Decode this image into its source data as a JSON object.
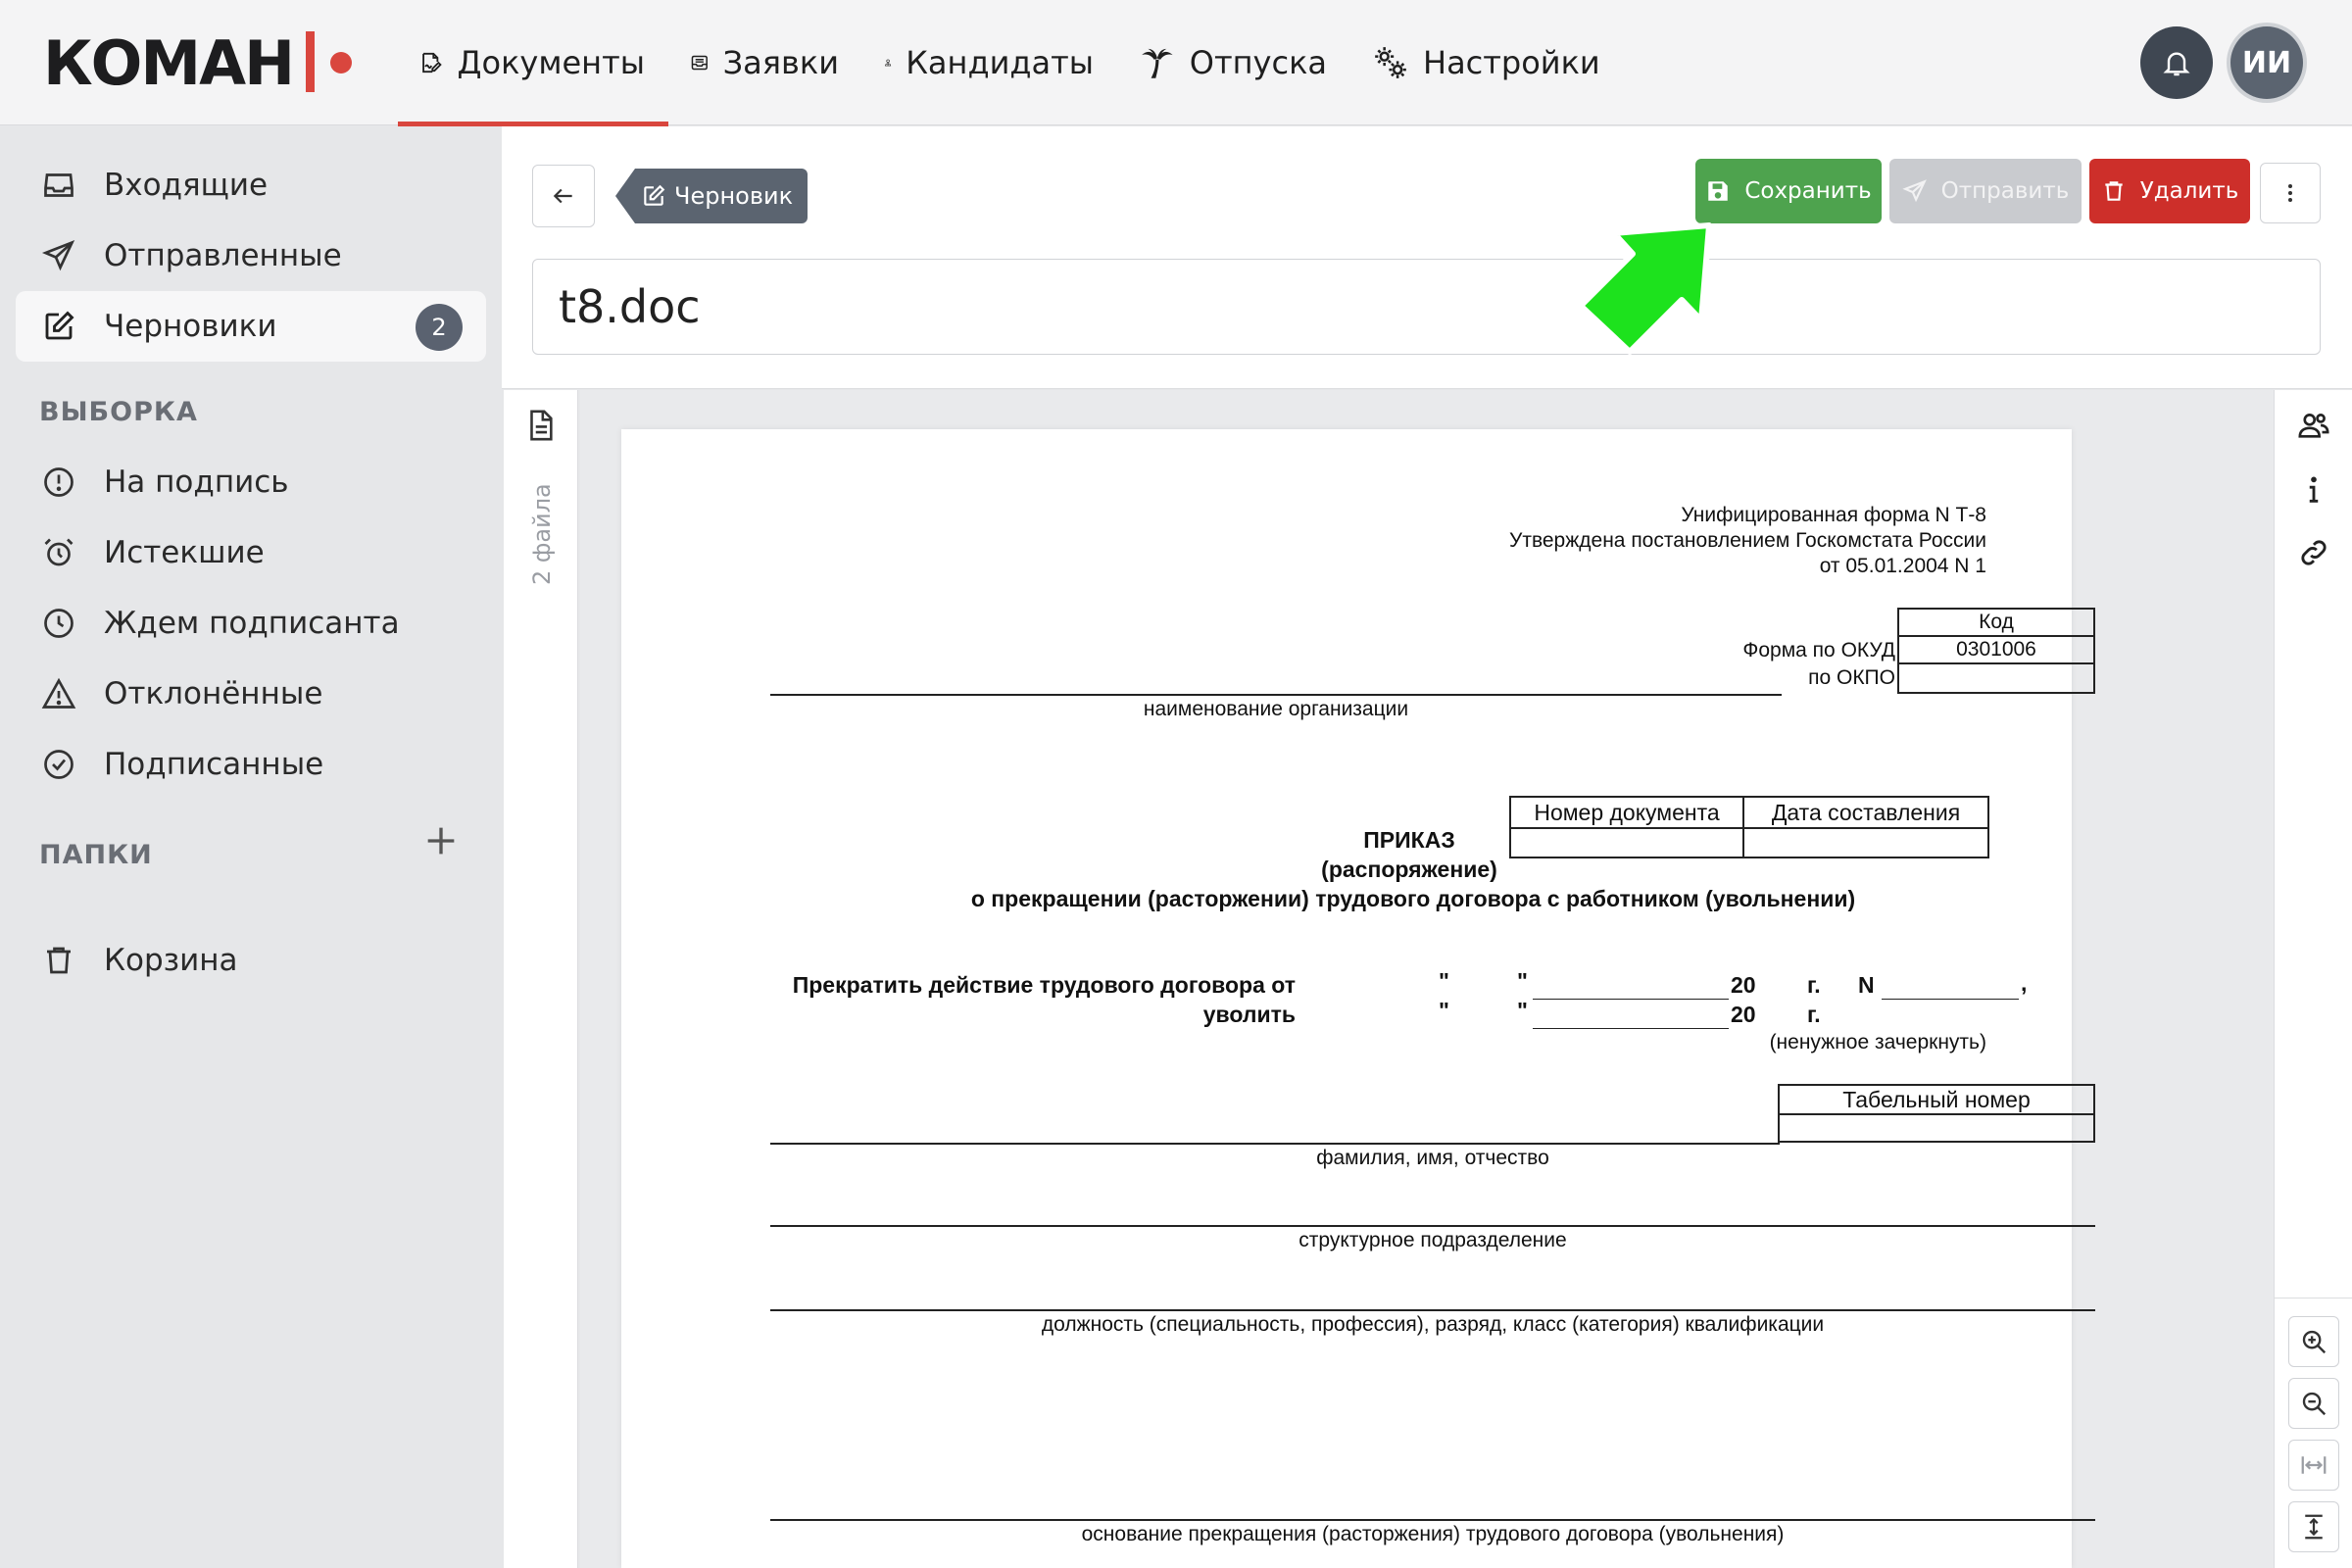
{
  "brand": {
    "name": "КОМАН"
  },
  "nav": [
    {
      "label": "Документы",
      "icon": "document-sign-icon",
      "active": true
    },
    {
      "label": "Заявки",
      "icon": "inbox-tray-icon"
    },
    {
      "label": "Кандидаты",
      "icon": "user-tie-icon"
    },
    {
      "label": "Отпуска",
      "icon": "palm-tree-icon"
    },
    {
      "label": "Настройки",
      "icon": "gears-icon"
    }
  ],
  "header": {
    "avatar_initials": "ИИ",
    "bell_icon": "bell-icon"
  },
  "sidebar": {
    "items": [
      {
        "label": "Входящие",
        "icon": "inbox-icon"
      },
      {
        "label": "Отправленные",
        "icon": "paper-plane-icon"
      },
      {
        "label": "Черновики",
        "icon": "edit-icon",
        "active": true,
        "badge": "2"
      }
    ],
    "filter_title": "ВЫБОРКА",
    "filters": [
      {
        "label": "На подпись",
        "icon": "exclamation-circle-icon"
      },
      {
        "label": "Истекшие",
        "icon": "alarm-clock-icon"
      },
      {
        "label": "Ждем подписанта",
        "icon": "clock-icon"
      },
      {
        "label": "Отклонённые",
        "icon": "warning-triangle-icon"
      },
      {
        "label": "Подписанные",
        "icon": "check-circle-icon"
      }
    ],
    "folders_title": "ПАПКИ",
    "trash_label": "Корзина"
  },
  "toolbar": {
    "status_tag": "Черновик",
    "save_label": "Сохранить",
    "send_label": "Отправить",
    "delete_label": "Удалить"
  },
  "document": {
    "title": "t8.doc",
    "files_count_label": "2 файла"
  },
  "form": {
    "header_line1": "Унифицированная форма N Т-8",
    "header_line2": "Утверждена постановлением Госкомстата России",
    "header_line3": "от 05.01.2004 N 1",
    "code_header": "Код",
    "okud_label": "Форма по ОКУД",
    "okud_code": "0301006",
    "okpo_label": "по ОКПО",
    "org_caption": "наименование организации",
    "doc_number_header": "Номер документа",
    "doc_date_header": "Дата составления",
    "title": "ПРИКАЗ",
    "subtitle": "(распоряжение)",
    "description": "о прекращении (расторжении) трудового договора с работником (увольнении)",
    "terminate_label": "Прекратить действие трудового договора от",
    "dismiss_label": "уволить",
    "quote": "\"",
    "year_prefix": "20",
    "year_suffix": "г.",
    "number_sign": "N",
    "comma": ",",
    "strike_note": "(ненужное зачеркнуть)",
    "tab_number_header": "Табельный номер",
    "fio_caption": "фамилия, имя, отчество",
    "division_caption": "структурное подразделение",
    "position_caption": "должность (специальность, профессия), разряд, класс (категория) квалификации",
    "basis_caption": "основание прекращения (расторжения) трудового договора (увольнения)"
  },
  "right_rail": {
    "icons": [
      "users-icon",
      "info-icon",
      "link-icon"
    ],
    "zoom": [
      "zoom-in-icon",
      "zoom-out-icon",
      "fit-width-icon",
      "fit-height-icon"
    ]
  },
  "colors": {
    "accent": "#d9463e",
    "save": "#4ea34e",
    "delete": "#cd2f2a",
    "send_disabled": "#c9cbcf",
    "annotation_arrow": "#1de21d"
  }
}
